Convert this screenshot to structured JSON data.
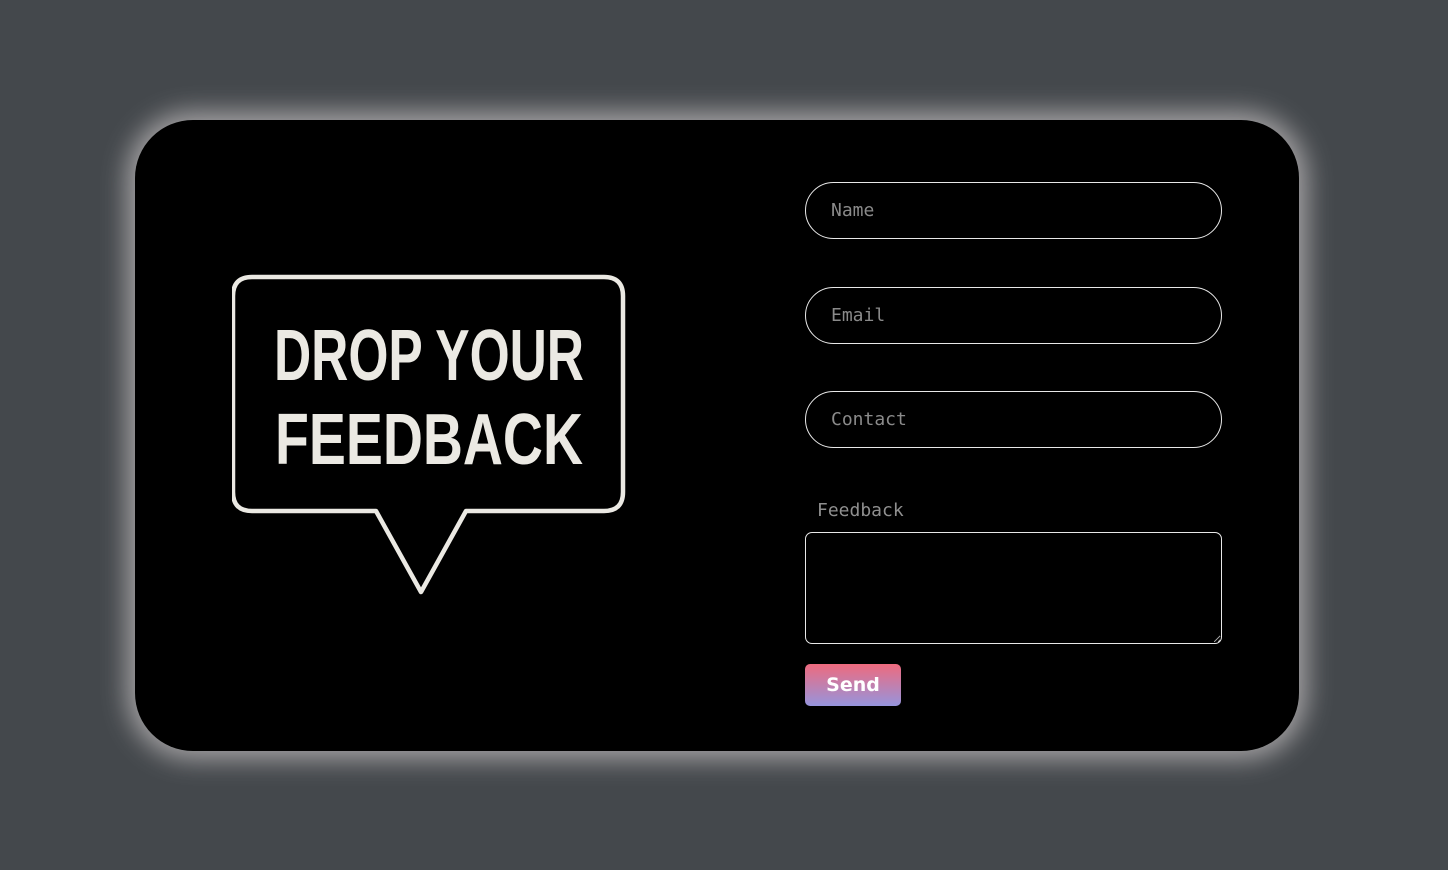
{
  "logo": {
    "line1": "DROP YOUR",
    "line2": "FEEDBACK",
    "icon": "speech-bubble-icon"
  },
  "form": {
    "name_placeholder": "Name",
    "email_placeholder": "Email",
    "contact_placeholder": "Contact",
    "feedback_label": "Feedback",
    "feedback_value": "",
    "send_label": "Send"
  },
  "colors": {
    "background": "#44484c",
    "card": "#000000",
    "border": "#e8e8e8",
    "button_gradient_top": "#ee6a7e",
    "button_gradient_bottom": "#9694dd"
  }
}
